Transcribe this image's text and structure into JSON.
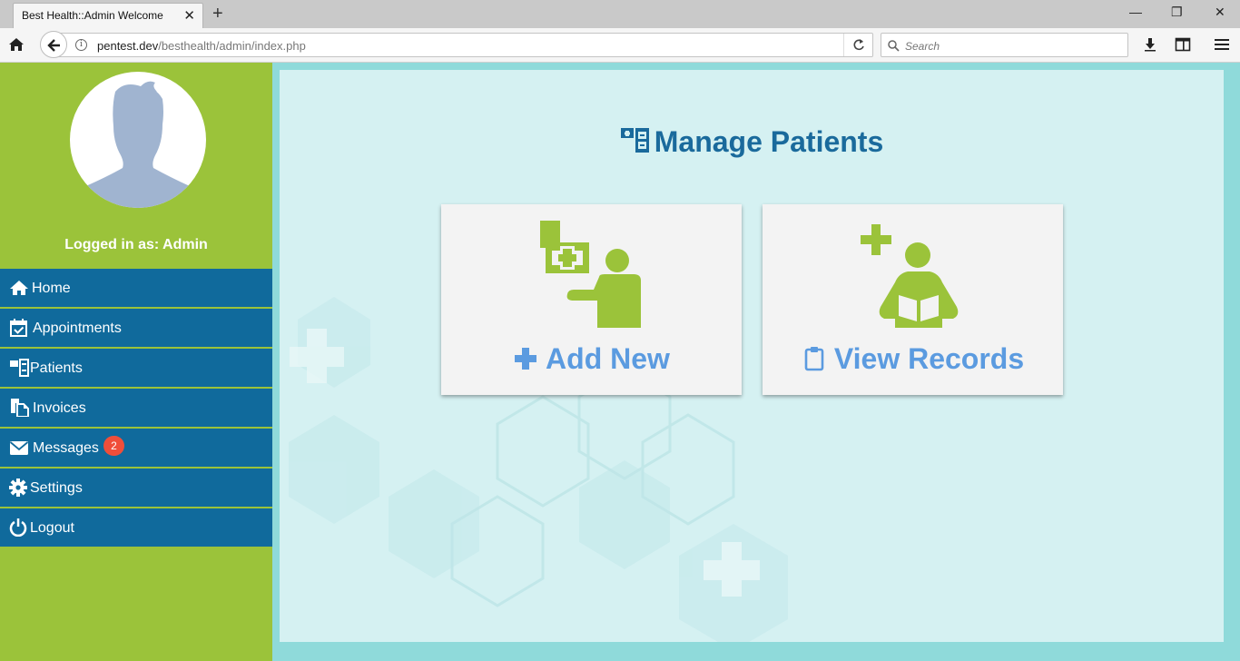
{
  "browser": {
    "tab_title": "Best Health::Admin Welcome",
    "url_host": "pentest.dev",
    "url_path": "/besthealth/admin/index.php",
    "search_placeholder": "Search"
  },
  "sidebar": {
    "logged_in_text": "Logged in as: Admin",
    "items": [
      {
        "label": "Home",
        "icon": "home-icon"
      },
      {
        "label": "Appointments",
        "icon": "calendar-check-icon"
      },
      {
        "label": "Patients",
        "icon": "patient-files-icon"
      },
      {
        "label": "Invoices",
        "icon": "documents-icon"
      },
      {
        "label": "Messages",
        "icon": "envelope-icon",
        "badge": "2"
      },
      {
        "label": "Settings",
        "icon": "gear-icon"
      },
      {
        "label": "Logout",
        "icon": "power-icon"
      }
    ]
  },
  "main": {
    "title": "Manage Patients",
    "cards": [
      {
        "label": "Add New",
        "icon": "plus-icon"
      },
      {
        "label": "View Records",
        "icon": "clipboard-icon"
      }
    ]
  },
  "colors": {
    "sidebar_green": "#9bc33a",
    "menu_blue": "#106a9c",
    "title_blue": "#1a6a9c",
    "card_label_blue": "#5b9be0",
    "badge_red": "#f04e3a",
    "content_bg": "#d5f1f2"
  }
}
